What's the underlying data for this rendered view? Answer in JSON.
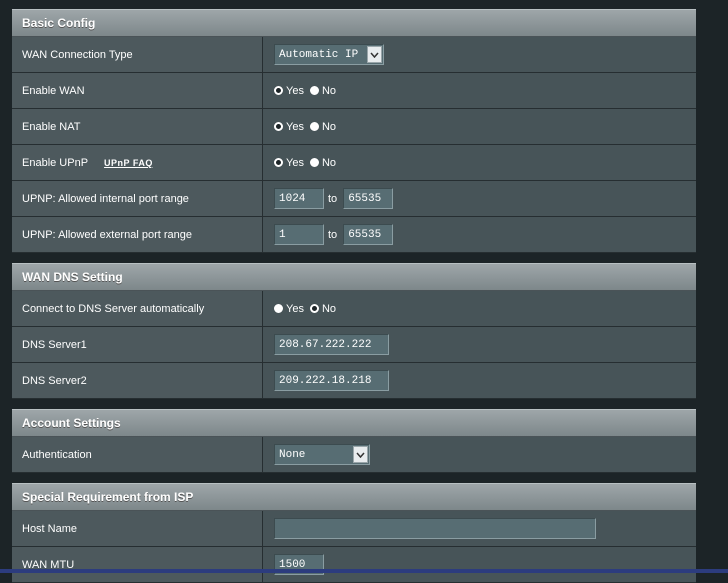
{
  "sections": {
    "basic": {
      "title": "Basic Config"
    },
    "dns": {
      "title": "WAN DNS Setting"
    },
    "account": {
      "title": "Account Settings"
    },
    "isp": {
      "title": "Special Requirement from ISP"
    }
  },
  "basic": {
    "wan_type": {
      "label": "WAN Connection Type",
      "selected": "Automatic IP"
    },
    "enable_wan": {
      "label": "Enable WAN",
      "yes": "Yes",
      "no": "No",
      "value": "yes"
    },
    "enable_nat": {
      "label": "Enable NAT",
      "yes": "Yes",
      "no": "No",
      "value": "yes"
    },
    "enable_upnp": {
      "label": "Enable UPnP",
      "faq": "UPnP FAQ",
      "yes": "Yes",
      "no": "No",
      "value": "yes"
    },
    "upnp_internal": {
      "label": "UPNP: Allowed internal port range",
      "from": "1024",
      "to_label": "to",
      "to": "65535"
    },
    "upnp_external": {
      "label": "UPNP: Allowed external port range",
      "from": "1",
      "to_label": "to",
      "to": "65535"
    }
  },
  "dns": {
    "auto": {
      "label": "Connect to DNS Server automatically",
      "yes": "Yes",
      "no": "No",
      "value": "no"
    },
    "server1": {
      "label": "DNS Server1",
      "value": "208.67.222.222"
    },
    "server2": {
      "label": "DNS Server2",
      "value": "209.222.18.218"
    }
  },
  "account": {
    "authentication": {
      "label": "Authentication",
      "selected": "None"
    }
  },
  "isp": {
    "host_name": {
      "label": "Host Name",
      "value": ""
    },
    "wan_mtu": {
      "label": "WAN MTU",
      "value": "1500"
    }
  }
}
